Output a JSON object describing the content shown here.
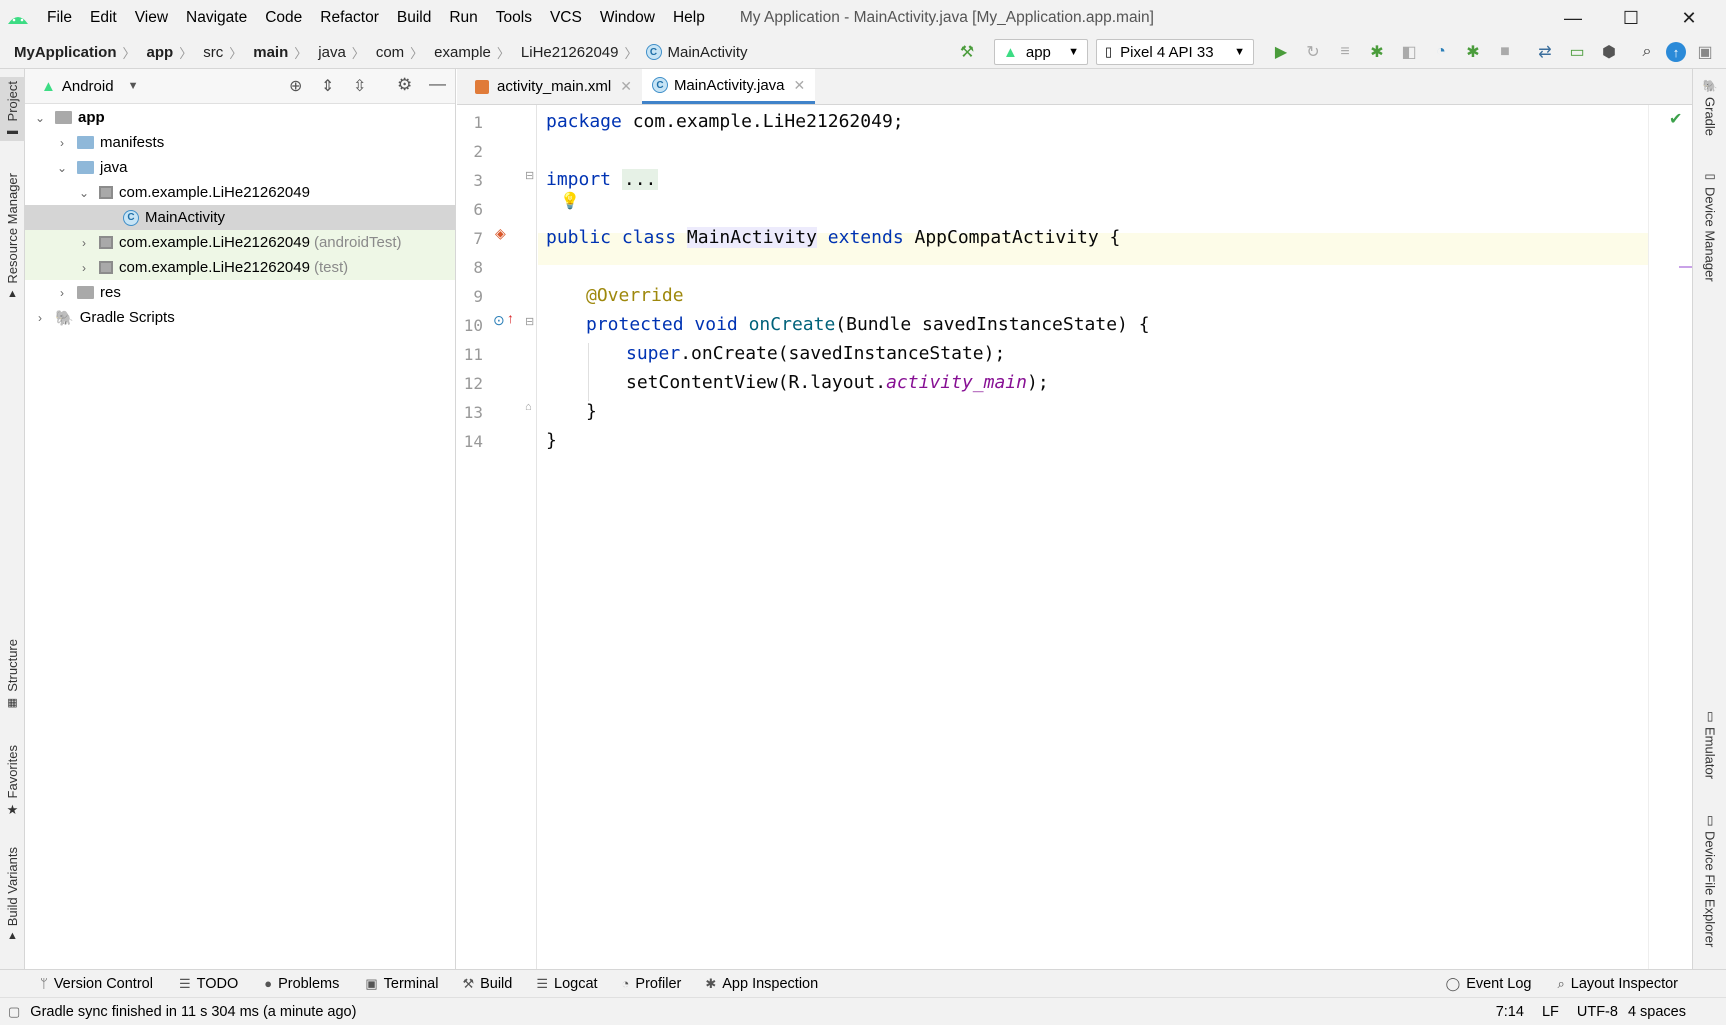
{
  "menubar": {
    "items": [
      "File",
      "Edit",
      "View",
      "Navigate",
      "Code",
      "Refactor",
      "Build",
      "Run",
      "Tools",
      "VCS",
      "Window",
      "Help"
    ],
    "title": "My Application - MainActivity.java [My_Application.app.main]"
  },
  "breadcrumbs": [
    "MyApplication",
    "app",
    "src",
    "main",
    "java",
    "com",
    "example",
    "LiHe21262049",
    "MainActivity"
  ],
  "toolbar": {
    "run_config": "app",
    "device": "Pixel 4 API 33"
  },
  "left_strip": {
    "project": "Project",
    "resource_manager": "Resource Manager",
    "structure": "Structure",
    "favorites": "Favorites",
    "build_variants": "Build Variants"
  },
  "right_strip": {
    "gradle": "Gradle",
    "device_manager": "Device Manager",
    "emulator": "Emulator",
    "device_file_explorer": "Device File Explorer"
  },
  "project_panel": {
    "view": "Android",
    "tree": {
      "app": "app",
      "manifests": "manifests",
      "java": "java",
      "pkg_main": "com.example.LiHe21262049",
      "main_activity": "MainActivity",
      "pkg_android_test": "com.example.LiHe21262049",
      "android_test_suffix": "(androidTest)",
      "pkg_test": "com.example.LiHe21262049",
      "test_suffix": "(test)",
      "res": "res",
      "gradle_scripts": "Gradle Scripts"
    }
  },
  "editor": {
    "tabs": [
      {
        "label": "activity_main.xml"
      },
      {
        "label": "MainActivity.java"
      }
    ],
    "line_numbers": [
      "1",
      "2",
      "3",
      "6",
      "7",
      "8",
      "9",
      "10",
      "11",
      "12",
      "13",
      "14"
    ],
    "code": {
      "l1_kw": "package",
      "l1_rest": " com.example.LiHe21262049;",
      "l3_kw": "import",
      "l3_fold": "...",
      "l7_kw1": "public",
      "l7_kw2": "class",
      "l7_cls": "MainActivity",
      "l7_kw3": "extends",
      "l7_rest": " AppCompatActivity {",
      "l9_ann": "@Override",
      "l10_kw1": "protected",
      "l10_kw2": "void",
      "l10_fn": "onCreate",
      "l10_rest": "(Bundle savedInstanceState) {",
      "l11_kw": "super",
      "l11_rest": ".onCreate(savedInstanceState);",
      "l12_pre": "setContentView(R.layout.",
      "l12_fld": "activity_main",
      "l12_post": ");",
      "l13": "}",
      "l14": "}"
    }
  },
  "bottom_tools": {
    "version_control": "Version Control",
    "todo": "TODO",
    "problems": "Problems",
    "terminal": "Terminal",
    "build": "Build",
    "logcat": "Logcat",
    "profiler": "Profiler",
    "app_inspection": "App Inspection",
    "event_log": "Event Log",
    "layout_inspector": "Layout Inspector"
  },
  "status": {
    "message": "Gradle sync finished in 11 s 304 ms (a minute ago)",
    "position": "7:14",
    "line_sep": "LF",
    "encoding": "UTF-8",
    "indent": "4 spaces"
  },
  "colors": {
    "accent": "#4083c9",
    "android_green": "#3ddc84",
    "keyword": "#0033b3",
    "annotation": "#9e880d"
  }
}
